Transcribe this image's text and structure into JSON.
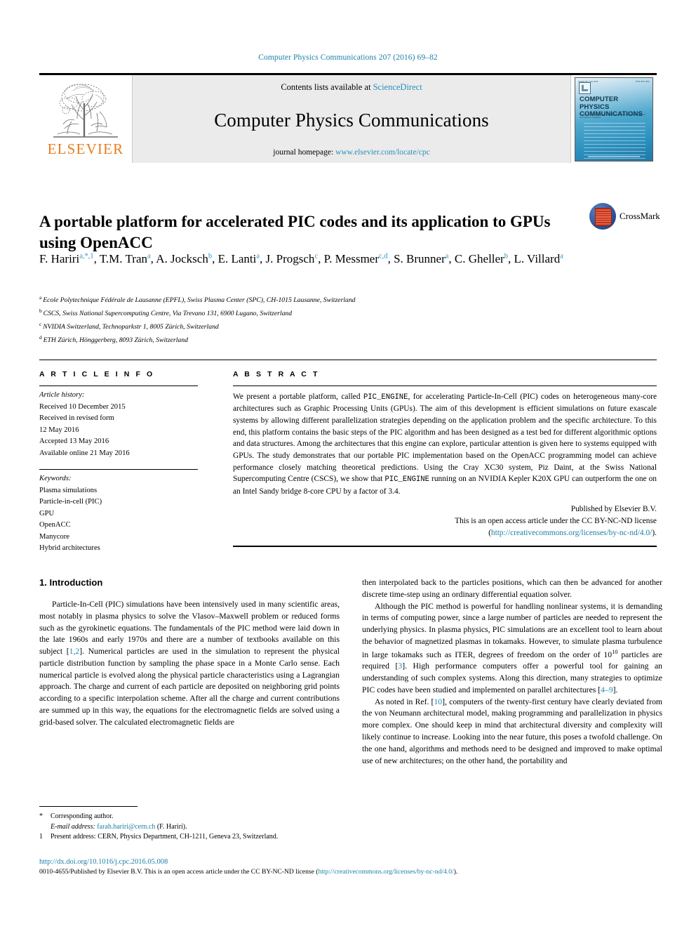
{
  "running_head": "Computer Physics Communications 207 (2016) 69–82",
  "masthead": {
    "publisher_logo_text": "ELSEVIER",
    "contents_prefix": "Contents lists available at",
    "contents_link": "ScienceDirect",
    "journal_name": "Computer Physics Communications",
    "homepage_prefix": "journal homepage:",
    "homepage_link": "www.elsevier.com/locate/cpc",
    "cover": {
      "title_line1": "COMPUTER PHYSICS",
      "title_line2": "COMMUNICATIONS",
      "subtitle": "An International Journal and Program Library for Computational Physics and Physical Chemistry",
      "volume_label": "Volume 207, June 2016",
      "issn_label": "ISSN 0010-4655"
    }
  },
  "article": {
    "title": "A portable platform for accelerated PIC codes and its application to GPUs using OpenACC",
    "crossmark_label": "CrossMark",
    "authors": [
      {
        "name": "F. Hariri",
        "marks": "a,*,1",
        "sep": ", "
      },
      {
        "name": "T.M. Tran",
        "marks": "a",
        "sep": ", "
      },
      {
        "name": "A. Jocksch",
        "marks": "b",
        "sep": ", "
      },
      {
        "name": "E. Lanti",
        "marks": "a",
        "sep": ", "
      },
      {
        "name": "J. Progsch",
        "marks": "c",
        "sep": ", "
      },
      {
        "name": "P. Messmer",
        "marks": "c,d",
        "sep": ", "
      },
      {
        "name": "S. Brunner",
        "marks": "a",
        "sep": ", "
      },
      {
        "name": "C. Gheller",
        "marks": "b",
        "sep": ", "
      },
      {
        "name": "L. Villard",
        "marks": "a",
        "sep": ""
      }
    ],
    "affiliations": [
      {
        "mark": "a",
        "text": "Ecole Polytechnique Fédérale de Lausanne (EPFL), Swiss Plasma Center (SPC), CH-1015 Lausanne, Switzerland"
      },
      {
        "mark": "b",
        "text": "CSCS, Swiss National Supercomputing Centre, Via Trevano 131, 6900 Lugano, Switzerland"
      },
      {
        "mark": "c",
        "text": "NVIDIA Switzerland, Technoparkstr 1, 8005 Zürich, Switzerland"
      },
      {
        "mark": "d",
        "text": "ETH Zürich, Hönggerberg, 8093 Zürich, Switzerland"
      }
    ]
  },
  "article_info": {
    "heading": "A R T I C L E   I N F O",
    "history_label": "Article history:",
    "history": [
      "Received 10 December 2015",
      "Received in revised form",
      "12 May 2016",
      "Accepted 13 May 2016",
      "Available online 21 May 2016"
    ],
    "keywords_label": "Keywords:",
    "keywords": [
      "Plasma simulations",
      "Particle-in-cell (PIC)",
      "GPU",
      "OpenACC",
      "Manycore",
      "Hybrid architectures"
    ]
  },
  "abstract": {
    "heading": "A B S T R A C T",
    "part1": "We present a portable platform, called ",
    "code1": "PIC_ENGINE",
    "part2": ", for accelerating Particle-In-Cell (PIC) codes on heterogeneous many-core architectures such as Graphic Processing Units (GPUs). The aim of this development is efficient simulations on future exascale systems by allowing different parallelization strategies depending on the application problem and the specific architecture. To this end, this platform contains the basic steps of the PIC algorithm and has been designed as a test bed for different algorithmic options and data structures. Among the architectures that this engine can explore, particular attention is given here to systems equipped with GPUs. The study demonstrates that our portable PIC implementation based on the OpenACC programming model can achieve performance closely matching theoretical predictions. Using the Cray XC30 system, Piz Daint, at the Swiss National Supercomputing Centre (CSCS), we show that ",
    "code2": "PIC_ENGINE",
    "part3": " running on an NVIDIA Kepler K20X GPU can outperform the one on an Intel Sandy bridge 8-core CPU by a factor of 3.4.",
    "published_by": "Published by Elsevier B.V.",
    "license_line": "This is an open access article under the CC BY-NC-ND license",
    "license_url_open": "(",
    "license_url": "http://creativecommons.org/licenses/by-nc-nd/4.0/",
    "license_url_close": ")."
  },
  "body": {
    "section_heading": "1. Introduction",
    "left_paragraphs": [
      {
        "segments": [
          {
            "t": "Particle-In-Cell (PIC) simulations have been intensively used in many scientific areas, most notably in plasma physics to solve the Vlasov–Maxwell problem or reduced forms such as the gyrokinetic equations. The fundamentals of the PIC method were laid down in the late 1960s and early 1970s and there are a number of textbooks available on this subject ["
          },
          {
            "t": "1,2",
            "ref": true
          },
          {
            "t": "]. Numerical particles are used in the simulation to represent the physical particle distribution function by sampling the phase space in a Monte Carlo sense. Each numerical particle is evolved along the physical particle characteristics using a Lagrangian approach. The charge and current of each particle are deposited on neighboring grid points according to a specific interpolation scheme. After all the charge and current contributions are summed up in this way, the equations for the electromagnetic fields are solved using a grid-based solver. The calculated electromagnetic fields are"
          }
        ],
        "indent": true
      }
    ],
    "right_paragraphs": [
      {
        "segments": [
          {
            "t": "then interpolated back to the particles positions, which can then be advanced for another discrete time-step using an ordinary differential equation solver."
          }
        ],
        "indent": false
      },
      {
        "segments": [
          {
            "t": "Although the PIC method is powerful for handling nonlinear systems, it is demanding in terms of computing power, since a large number of particles are needed to represent the underlying physics. In plasma physics, PIC simulations are an excellent tool to learn about the behavior of magnetized plasmas in tokamaks. However, to simulate plasma turbulence in large tokamaks such as ITER, degrees of freedom on the order of 10"
          },
          {
            "t": "10",
            "sup": true
          },
          {
            "t": " particles are required ["
          },
          {
            "t": "3",
            "ref": true
          },
          {
            "t": "]. High performance computers offer a powerful tool for gaining an understanding of such complex systems. Along this direction, many strategies to optimize PIC codes have been studied and implemented on parallel architectures ["
          },
          {
            "t": "4–9",
            "ref": true
          },
          {
            "t": "]."
          }
        ],
        "indent": true
      },
      {
        "segments": [
          {
            "t": "As noted in Ref. ["
          },
          {
            "t": "10",
            "ref": true
          },
          {
            "t": "], computers of the twenty-first century have clearly deviated from the von Neumann architectural model, making programming and parallelization in physics more complex. One should keep in mind that architectural diversity and complexity will likely continue to increase. Looking into the near future, this poses a twofold challenge. On the one hand, algorithms and methods need to be designed and improved to make optimal use of new architectures; on the other hand, the portability and"
          }
        ],
        "indent": true
      }
    ]
  },
  "footnotes": [
    {
      "mark": "*",
      "text": "Corresponding author."
    },
    {
      "mark": "",
      "label": "E-mail address:",
      "link": "farah.hariri@cern.ch",
      "text": " (F. Hariri)."
    },
    {
      "mark": "1",
      "text": "Present address: CERN, Physics Department, CH-1211, Geneva 23, Switzerland."
    }
  ],
  "bottom": {
    "doi": "http://dx.doi.org/10.1016/j.cpc.2016.05.008",
    "copyright_prefix": "0010-4655/Published by Elsevier B.V. This is an open access article under the CC BY-NC-ND license (",
    "copyright_link": "http://creativecommons.org/licenses/by-nc-nd/4.0/",
    "copyright_suffix": ")."
  },
  "colors": {
    "link_blue": "#1b7fa8",
    "elsevier_orange": "#e87d1e",
    "cover_blue": "#2b8fbd",
    "ref_blue": "#1b8ab5"
  }
}
